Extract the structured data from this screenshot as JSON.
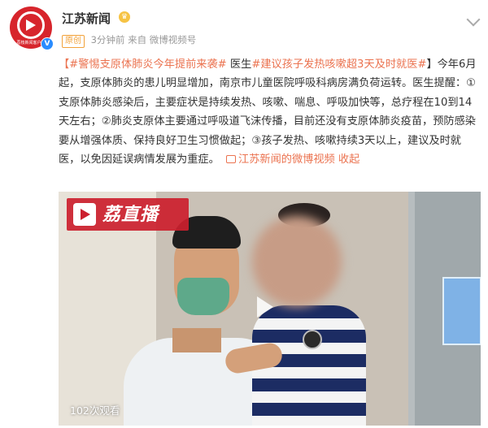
{
  "account": {
    "name": "江苏新闻",
    "avatar_text": "荔枝新闻客户端",
    "original_tag": "原创",
    "time": "3分钟前",
    "source_prefix": "来自",
    "source": "微博视频号"
  },
  "post": {
    "topic1": "【#警惕支原体肺炎今年提前来袭#",
    "mid1": " 医生",
    "topic2": "#建议孩子发热咳嗽超3天及时就医#",
    "body": "】今年6月起，支原体肺炎的患儿明显增加，南京市儿童医院呼吸科病房满负荷运转。医生提醒：①支原体肺炎感染后，主要症状是持续发热、咳嗽、喘息、呼吸加快等，总疗程在10到14天左右；②肺炎支原体主要通过呼吸道飞沫传播，目前还没有支原体肺炎疫苗，预防感染要从增强体质、保持良好卫生习惯做起；③孩子发热、咳嗽持续3天以上，建议及时就医，以免因延误病情发展为重症。",
    "video_link": "江苏新闻的微博视频",
    "collapse": "收起"
  },
  "video": {
    "logo_text": "荔直播",
    "views": "102次观看"
  }
}
